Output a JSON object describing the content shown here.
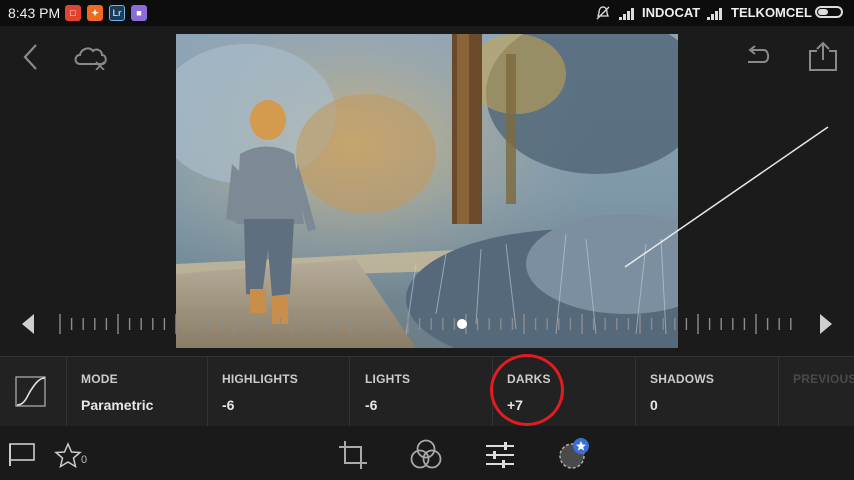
{
  "statusbar": {
    "time": "8:43 PM",
    "carrier1": "INDOCAT",
    "carrier2": "TELKOMCEL"
  },
  "panel": {
    "mode": {
      "label": "MODE",
      "value": "Parametric"
    },
    "highlights": {
      "label": "HIGHLIGHTS",
      "value": "-6"
    },
    "lights": {
      "label": "LIGHTS",
      "value": "-6"
    },
    "darks": {
      "label": "DARKS",
      "value": "+7"
    },
    "shadows": {
      "label": "SHADOWS",
      "value": "0"
    },
    "previous": {
      "label": "PREVIOUS"
    }
  },
  "toolbar": {
    "rating_count": "0"
  },
  "colors": {
    "accent_highlight": "#e31b23",
    "badge_blue": "#3b6fd8"
  }
}
